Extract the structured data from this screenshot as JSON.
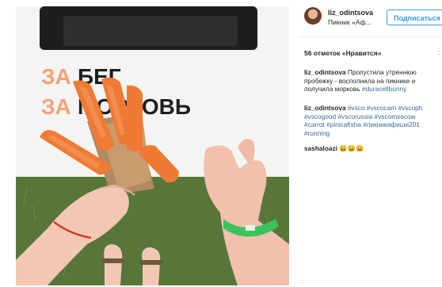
{
  "post": {
    "username": "liz_odintsova",
    "location": "Пикник «Аф...",
    "follow_label": "Подписаться",
    "likes_text": "56 отметок «Нравится»",
    "caption": {
      "author": "liz_odintsova",
      "text": "Пропустила утреннюю пробежку - восполнила на пикнике и получила морковь",
      "hashtag": "#duracellbunny"
    },
    "comments": [
      {
        "author": "liz_odintsova",
        "line1_tags": "#vsco #vscocam #vscoph",
        "line2_tags": "#vscogood #vscorussia #vscomoscow",
        "line3_tags": "#carrot #pinicafisha #пикникафиши201",
        "line4_tags": "#running"
      },
      {
        "author": "sashaloazi",
        "text": "😀😀😀"
      }
    ]
  },
  "photo": {
    "banner_line1_a": "ЗА",
    "banner_line1_b": "БЕГ",
    "banner_line2_a": "ЗА",
    "banner_line2_b": "МОРКОВЬ",
    "colors": {
      "grass": "#5d7a3a",
      "banner": "#f4f4f2",
      "carrot": "#ec7a3a",
      "accent_orange": "#f29a6c",
      "wristband": "#3cc25a"
    }
  }
}
